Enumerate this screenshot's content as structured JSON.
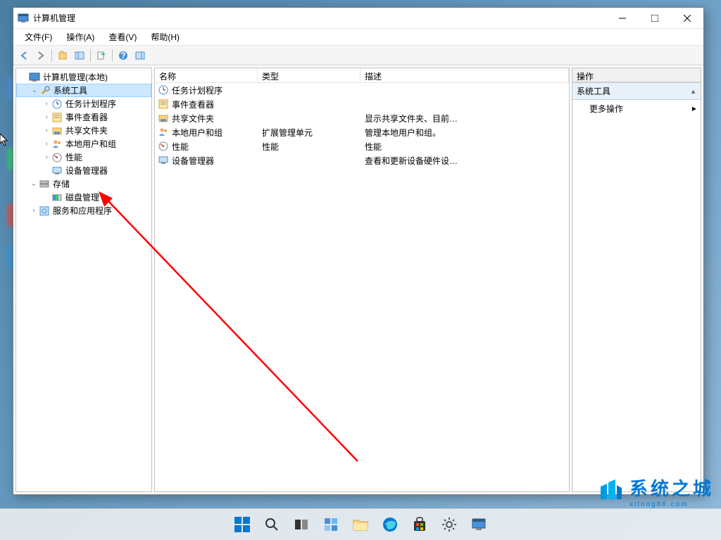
{
  "window": {
    "title": "计算机管理",
    "menus": [
      "文件(F)",
      "操作(A)",
      "查看(V)",
      "帮助(H)"
    ]
  },
  "tree": {
    "root": "计算机管理(本地)",
    "system_tools": "系统工具",
    "items": [
      "任务计划程序",
      "事件查看器",
      "共享文件夹",
      "本地用户和组",
      "性能",
      "设备管理器"
    ],
    "storage": "存储",
    "disk_mgmt": "磁盘管理",
    "services": "服务和应用程序"
  },
  "list": {
    "columns": {
      "name": "名称",
      "type": "类型",
      "desc": "描述"
    },
    "rows": [
      {
        "name": "任务计划程序",
        "type": "",
        "desc": ""
      },
      {
        "name": "事件查看器",
        "type": "",
        "desc": ""
      },
      {
        "name": "共享文件夹",
        "type": "",
        "desc": "显示共享文件夹、目前…"
      },
      {
        "name": "本地用户和组",
        "type": "扩展管理单元",
        "desc": "管理本地用户和组。"
      },
      {
        "name": "性能",
        "type": "性能",
        "desc": "性能"
      },
      {
        "name": "设备管理器",
        "type": "",
        "desc": "查看和更新设备硬件设…"
      }
    ]
  },
  "actions": {
    "header": "操作",
    "section": "系统工具",
    "more": "更多操作"
  },
  "watermark": {
    "main": "系统之城",
    "sub": "xitong86.com"
  }
}
